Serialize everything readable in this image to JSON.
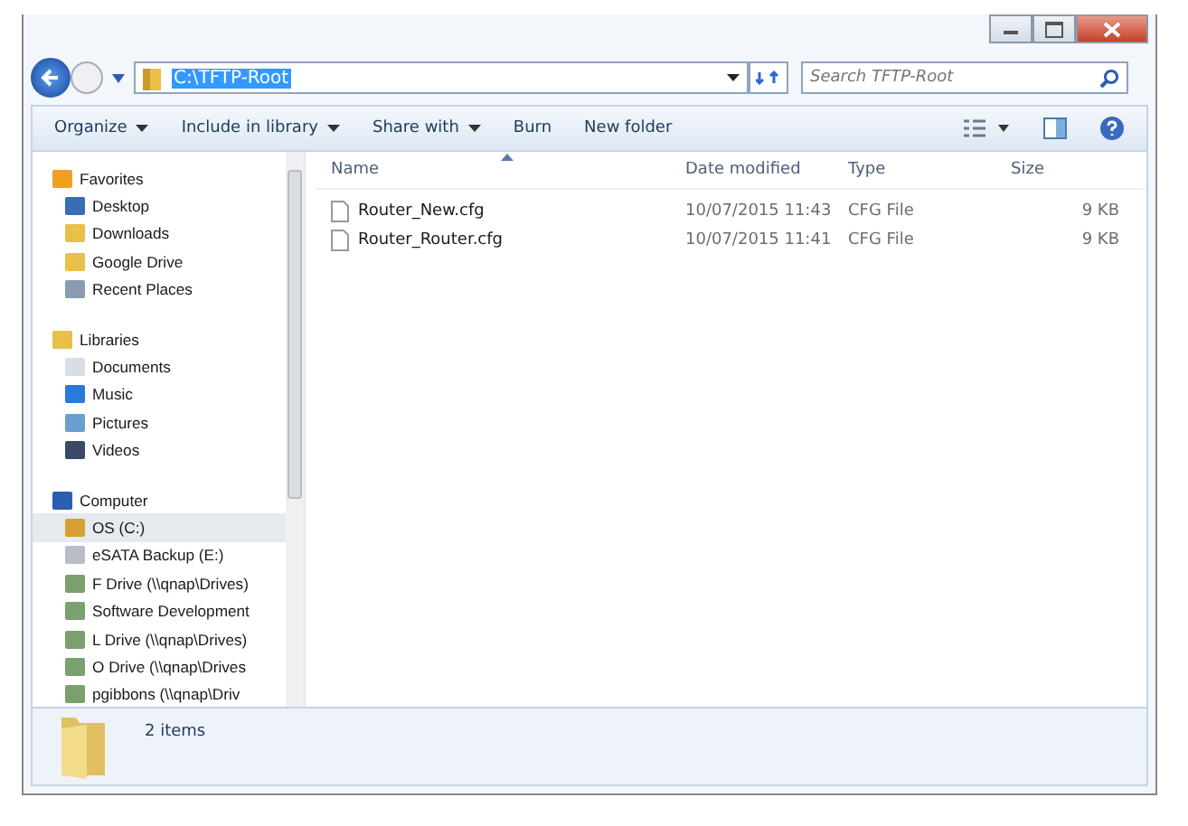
{
  "address_bar": {
    "path": "C:\\TFTP-Root",
    "highlighted": true
  },
  "search": {
    "placeholder": "Search TFTP-Root"
  },
  "toolbar": {
    "buttons": [
      {
        "label": "Organize",
        "dropdown": true
      },
      {
        "label": "Include in library",
        "dropdown": true
      },
      {
        "label": "Share with",
        "dropdown": true
      },
      {
        "label": "Burn",
        "dropdown": false
      },
      {
        "label": "New folder",
        "dropdown": false
      }
    ]
  },
  "sidebar": {
    "groups": [
      {
        "label": "Favorites",
        "kind": "star",
        "selected": false,
        "children": [
          {
            "label": "Desktop",
            "kind": "desktop",
            "selected": false
          },
          {
            "label": "Downloads",
            "kind": "folder",
            "selected": false
          },
          {
            "label": "Google Drive",
            "kind": "folder",
            "selected": false
          },
          {
            "label": "Recent Places",
            "kind": "recent",
            "selected": false
          }
        ]
      },
      {
        "label": "Libraries",
        "kind": "library",
        "selected": false,
        "children": [
          {
            "label": "Documents",
            "kind": "document",
            "selected": false
          },
          {
            "label": "Music",
            "kind": "music",
            "selected": false
          },
          {
            "label": "Pictures",
            "kind": "picture",
            "selected": false
          },
          {
            "label": "Videos",
            "kind": "video",
            "selected": false
          }
        ]
      },
      {
        "label": "Computer",
        "kind": "computer",
        "selected": false,
        "children": [
          {
            "label": "OS (C:)",
            "kind": "os",
            "selected": true
          },
          {
            "label": "eSATA Backup (E:)",
            "kind": "drive",
            "selected": false
          },
          {
            "label": "F Drive (\\\\qnap\\Drives)",
            "kind": "netdrive",
            "selected": false
          },
          {
            "label": "Software Development",
            "kind": "netdrive",
            "selected": false
          },
          {
            "label": "L Drive (\\\\qnap\\Drives)",
            "kind": "netdrive",
            "selected": false
          },
          {
            "label": "O Drive (\\\\qnap\\Drives",
            "kind": "netdrive",
            "selected": false
          },
          {
            "label": "pgibbons (\\\\qnap\\Driv",
            "kind": "netdrive",
            "selected": false
          }
        ]
      }
    ]
  },
  "file_list": {
    "columns": [
      {
        "label": "Name",
        "sorted": true
      },
      {
        "label": "Date modified",
        "sorted": false
      },
      {
        "label": "Type",
        "sorted": false
      },
      {
        "label": "Size",
        "sorted": false
      }
    ],
    "rows": [
      {
        "name": "Router_New.cfg",
        "date_modified": "10/07/2015 11:43",
        "type": "CFG File",
        "size": "9 KB"
      },
      {
        "name": "Router_Router.cfg",
        "date_modified": "10/07/2015 11:41",
        "type": "CFG File",
        "size": "9 KB"
      }
    ]
  },
  "status_bar": {
    "item_count": "2 items"
  }
}
